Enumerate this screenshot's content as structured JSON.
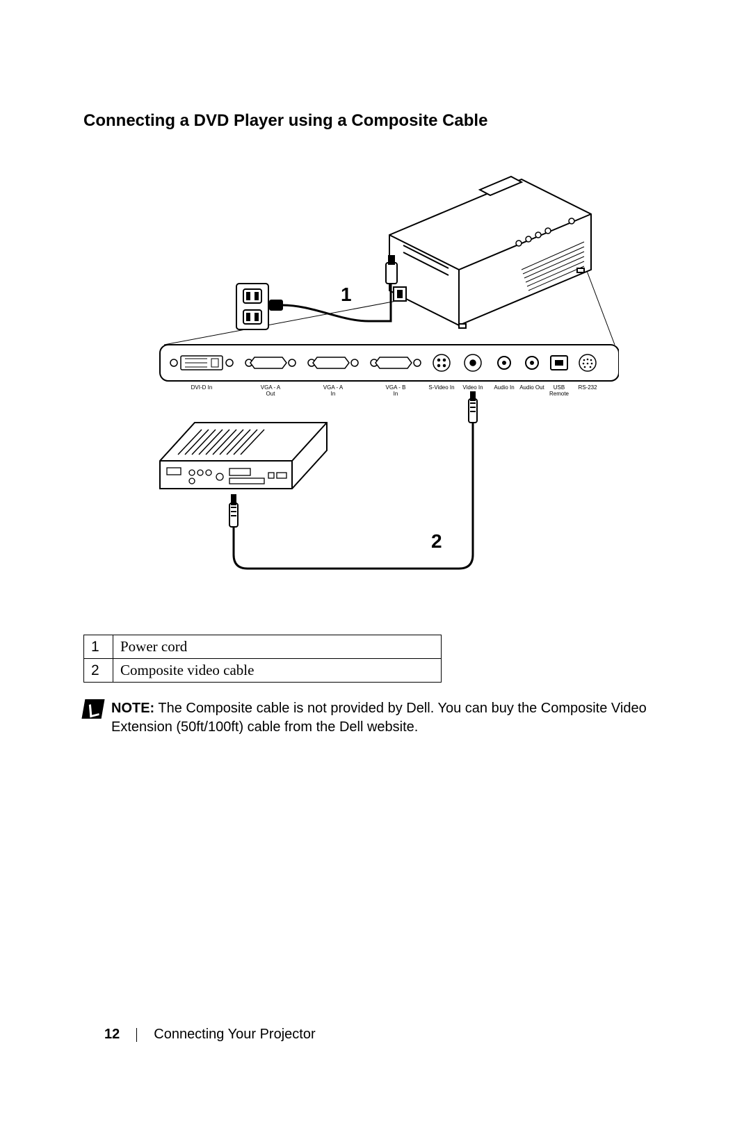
{
  "heading": "Connecting a DVD Player using a Composite Cable",
  "diagram": {
    "callout1": "1",
    "callout2": "2",
    "ports": {
      "dvi_d": "DVI-D In",
      "vga_a_out": "VGA - A\nOut",
      "vga_a_in": "VGA - A\nIn",
      "vga_b_in": "VGA - B\nIn",
      "svideo": "S-Video In",
      "video": "Video In",
      "audio_in": "Audio In",
      "audio_out": "Audio Out",
      "usb": "USB\nRemote",
      "rs232": "RS-232"
    }
  },
  "legend": [
    {
      "num": "1",
      "label": "Power cord"
    },
    {
      "num": "2",
      "label": "Composite video cable"
    }
  ],
  "note": {
    "lead": "NOTE:",
    "body": " The Composite cable is not provided by Dell. You can buy the Composite Video Extension (50ft/100ft) cable from the Dell website."
  },
  "footer": {
    "page": "12",
    "section": "Connecting Your Projector"
  }
}
